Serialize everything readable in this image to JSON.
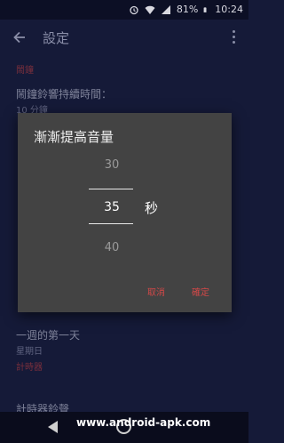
{
  "status_bar": {
    "battery": "81%",
    "time": "10:24"
  },
  "app_bar": {
    "title": "設定"
  },
  "sections": {
    "alarm_header": "鬧鐘",
    "alarm_duration_title": "鬧鐘鈴響持續時間：",
    "alarm_duration_value": "10 分鐘",
    "first_day_title": "一週的第一天",
    "first_day_value": "星期日",
    "timer_header": "計時器",
    "timer_item_partial": "計時器鈴聲"
  },
  "dialog": {
    "title": "漸漸提高音量",
    "picker_prev": "30",
    "picker_selected": "35",
    "picker_next": "40",
    "unit": "秒",
    "cancel_label": "取消",
    "ok_label": "確定"
  },
  "watermark": "www.android-apk.com",
  "colors": {
    "background": "#151a38",
    "dialog": "#434343",
    "accent": "#d24848"
  }
}
